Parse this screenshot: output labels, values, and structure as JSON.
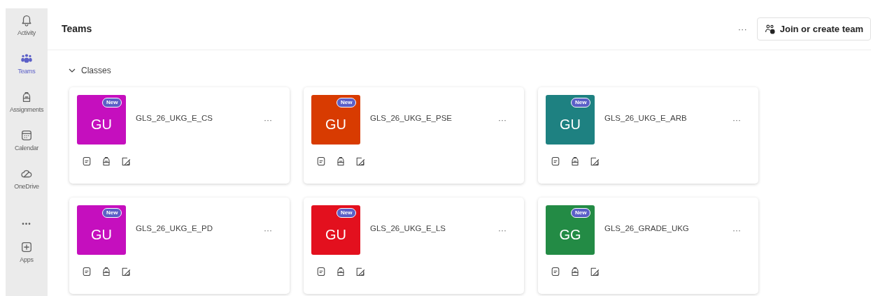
{
  "sidebar": {
    "items": [
      {
        "kind": "bell",
        "label": "Activity",
        "selected": false
      },
      {
        "kind": "teams",
        "label": "Teams",
        "selected": true
      },
      {
        "kind": "backpack",
        "label": "Assignments",
        "selected": false
      },
      {
        "kind": "calendar",
        "label": "Calendar",
        "selected": false
      },
      {
        "kind": "cloud",
        "label": "OneDrive",
        "selected": false
      },
      {
        "kind": "more",
        "label": "•••",
        "selected": false
      },
      {
        "kind": "apps",
        "label": "Apps",
        "selected": false
      }
    ]
  },
  "header": {
    "title": "Teams",
    "more": "···",
    "join_button": "Join or create team"
  },
  "section": {
    "title": "Classes",
    "expanded": true,
    "teams": [
      {
        "initials": "GU",
        "badge": "New",
        "name": "GLS_26_UKG_E_CS",
        "color": "#c50fbe",
        "more": "···"
      },
      {
        "initials": "GU",
        "badge": "New",
        "name": "GLS_26_UKG_E_PSE",
        "color": "#d83b01",
        "more": "···"
      },
      {
        "initials": "GU",
        "badge": "New",
        "name": "GLS_26_UKG_E_ARB",
        "color": "#1e8181",
        "more": "···"
      },
      {
        "initials": "GU",
        "badge": "New",
        "name": "GLS_26_UKG_E_PD",
        "color": "#c50fbe",
        "more": "···"
      },
      {
        "initials": "GU",
        "badge": "New",
        "name": "GLS_26_UKG_E_LS",
        "color": "#e3101e",
        "more": "···"
      },
      {
        "initials": "GG",
        "badge": "New",
        "name": "GLS_26_GRADE_UKG",
        "color": "#238b45",
        "more": "···"
      }
    ]
  }
}
